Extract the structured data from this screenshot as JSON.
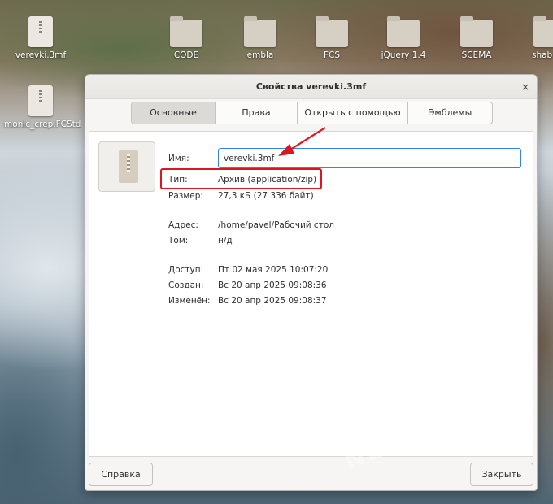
{
  "desktop": {
    "icons": [
      {
        "label": "verevki.3mf",
        "kind": "file"
      },
      {
        "label": "CODE",
        "kind": "folder"
      },
      {
        "label": "embla",
        "kind": "folder"
      },
      {
        "label": "FCS",
        "kind": "folder"
      },
      {
        "label": "jQuery 1.4",
        "kind": "folder"
      },
      {
        "label": "SCEMA",
        "kind": "folder"
      },
      {
        "label": "shab",
        "kind": "folder"
      },
      {
        "label": "monic_crep.FCStd",
        "kind": "file"
      }
    ]
  },
  "dialog": {
    "title": "Свойства verevki.3mf",
    "close_icon": "×",
    "tabs": [
      "Основные",
      "Права",
      "Открыть с помощью",
      "Эмблемы"
    ],
    "active_tab": "Основные",
    "icon": "zip-archive-file-icon",
    "fields": {
      "name_label": "Имя:",
      "name_value": "verevki.3mf",
      "type_label": "Тип:",
      "type_value": "Архив (application/zip)",
      "size_label": "Размер:",
      "size_value": "27,3 кБ (27 336 байт)",
      "address_label": "Адрес:",
      "address_value": "/home/pavel/Рабочий стол",
      "volume_label": "Том:",
      "volume_value": "н/д",
      "access_label": "Доступ:",
      "access_value": "Пт 02 мая 2025 10:07:20",
      "created_label": "Создан:",
      "created_value": "Вс 20 апр 2025 09:08:36",
      "modified_label": "Изменён:",
      "modified_value": "Вс 20 апр 2025 09:08:37"
    },
    "buttons": {
      "help": "Справка",
      "close": "Закрыть"
    }
  },
  "annotation": {
    "color": "#e0141b"
  },
  "watermark": "NEVOR.RU",
  "colors": {
    "accent": "#3584e4",
    "dialog_bg": "#f6f5f4"
  }
}
